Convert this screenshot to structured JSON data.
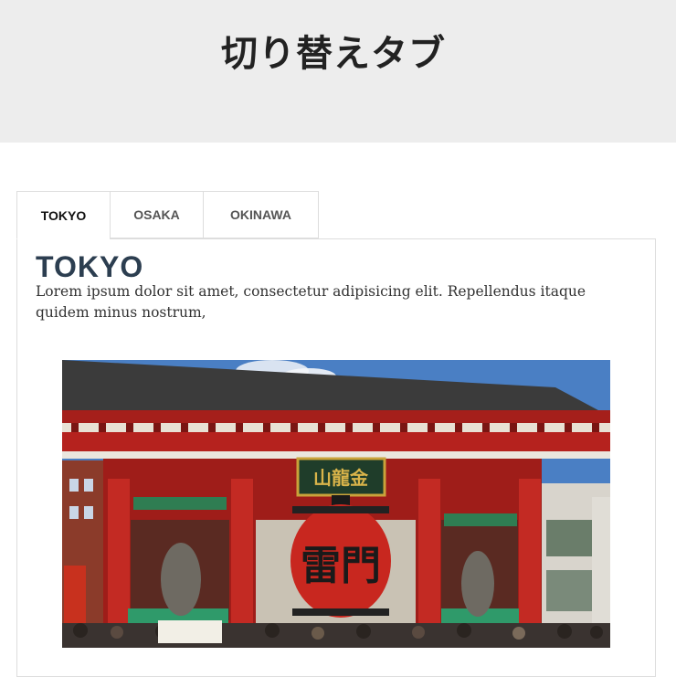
{
  "header": {
    "title": "切り替えタブ"
  },
  "tabs": [
    {
      "label": "TOKYO",
      "active": true
    },
    {
      "label": "OSAKA",
      "active": false
    },
    {
      "label": "OKINAWA",
      "active": false
    }
  ],
  "panel": {
    "heading": "TOKYO",
    "body": "Lorem ipsum dolor sit amet, consectetur adipisicing elit. Repellendus itaque quidem minus nostrum,",
    "image": {
      "subject": "kaminarimon-gate-photo",
      "plaque_text": "山龍金",
      "lantern_text": "雷門"
    }
  },
  "colors": {
    "header_bg": "#ededed",
    "heading": "#2c3e50",
    "gate_red": "#b5221e",
    "border": "#dddddd"
  }
}
